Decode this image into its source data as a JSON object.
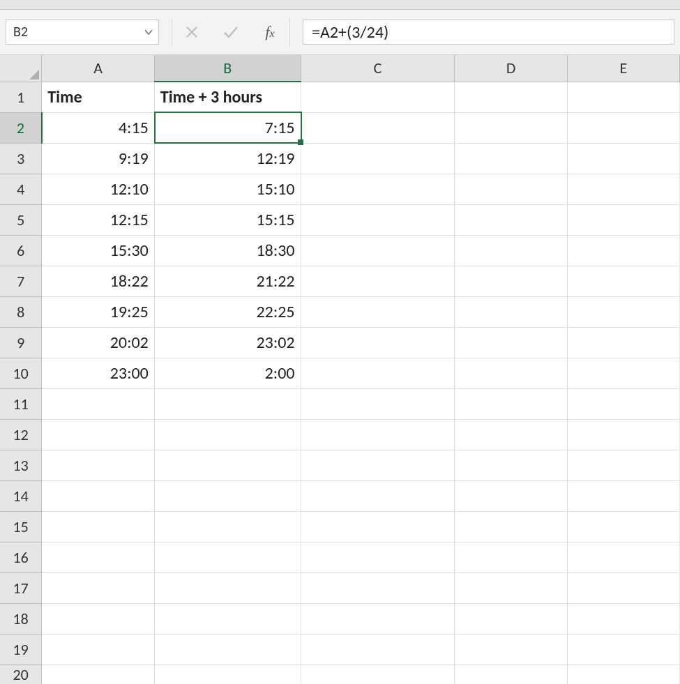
{
  "nameBox": {
    "value": "B2"
  },
  "formulaBar": {
    "value": "=A2+(3/24)"
  },
  "columns": [
    "A",
    "B",
    "C",
    "D",
    "E"
  ],
  "rowCount": 19,
  "extraRowLabel": "20",
  "headers": {
    "A": "Time",
    "B": "Time + 3 hours"
  },
  "data": {
    "A": [
      "4:15",
      "9:19",
      "12:10",
      "12:15",
      "15:30",
      "18:22",
      "19:25",
      "20:02",
      "23:00"
    ],
    "B": [
      "7:15",
      "12:19",
      "15:10",
      "15:15",
      "18:30",
      "21:22",
      "22:25",
      "23:02",
      "2:00"
    ]
  },
  "activeCell": {
    "col": "B",
    "row": 2
  }
}
